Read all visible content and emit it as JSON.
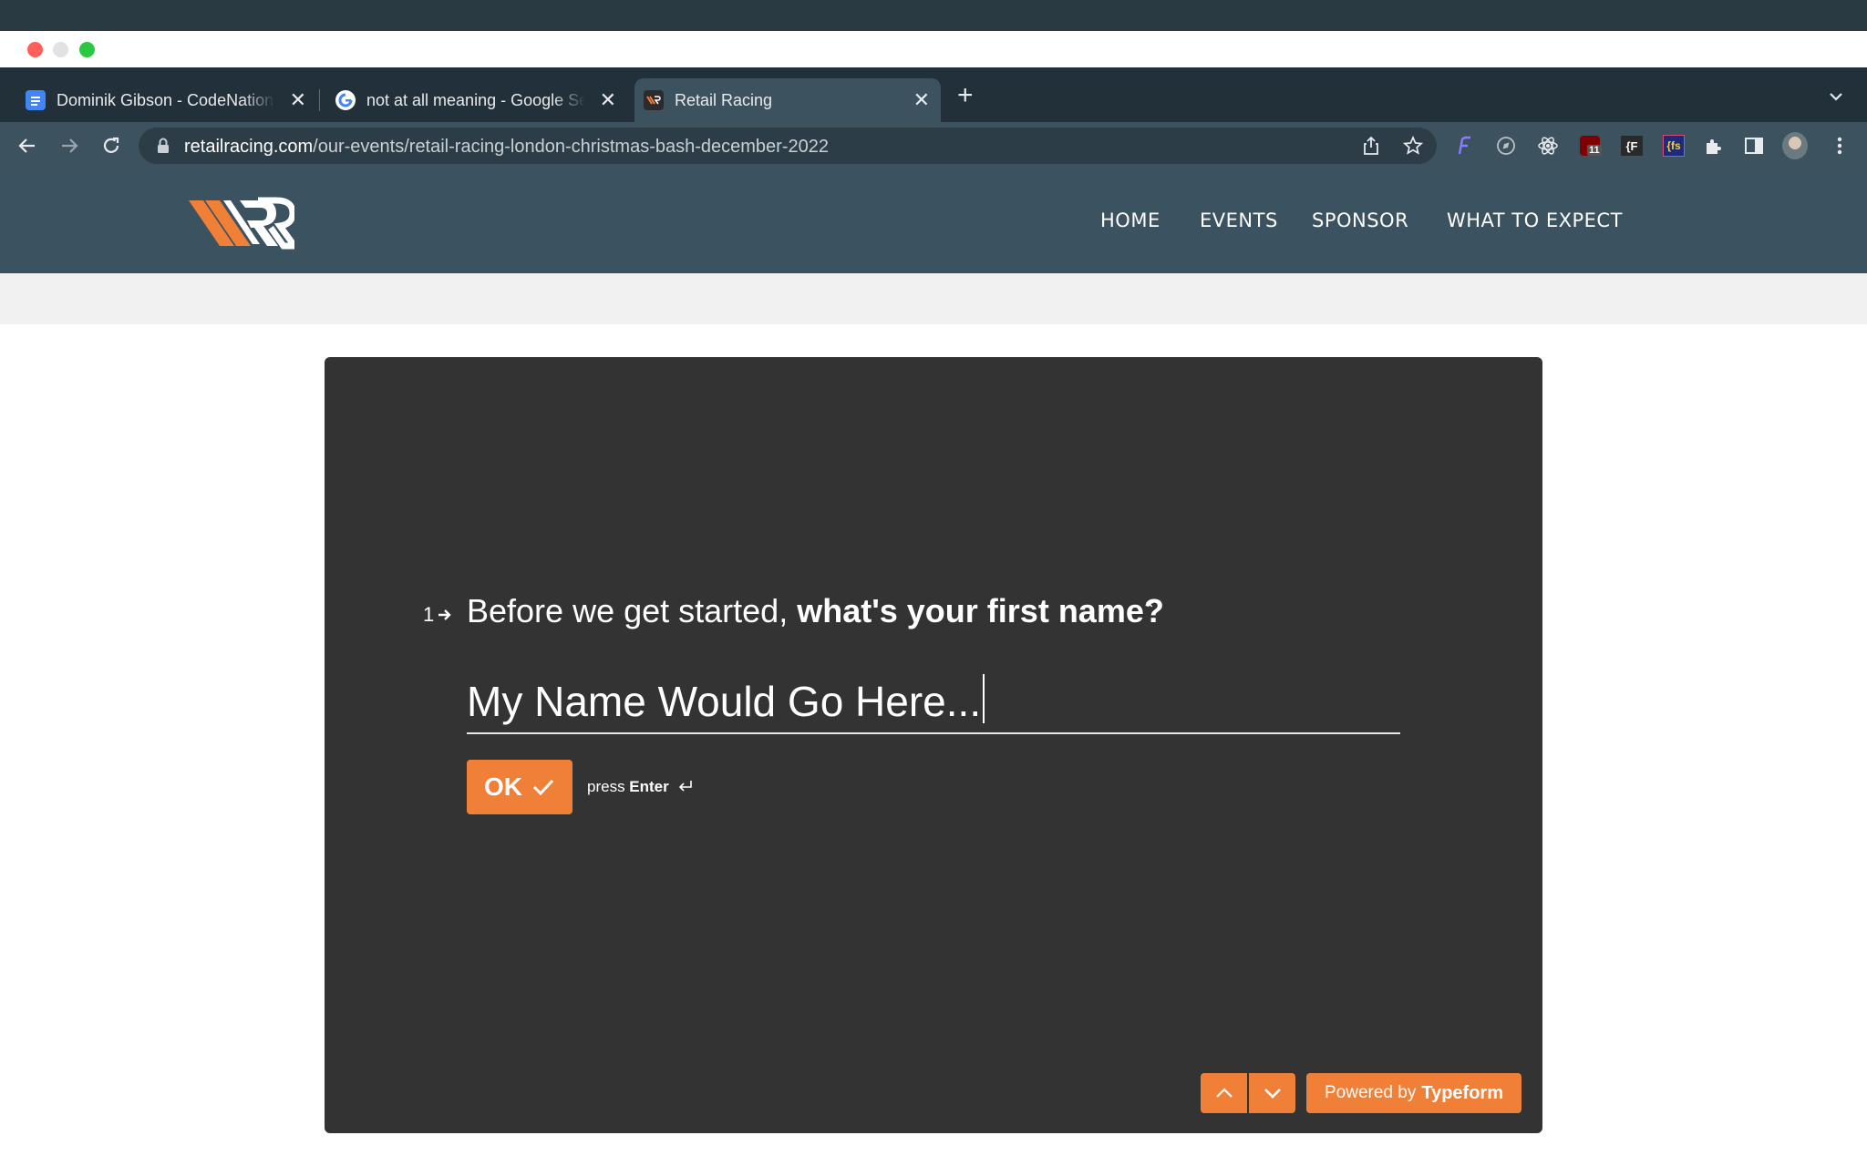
{
  "browser": {
    "tabs": [
      {
        "label": "Dominik Gibson - CodeNation",
        "active": false
      },
      {
        "label": "not at all meaning - Google Search",
        "active": false
      },
      {
        "label": "Retail Racing",
        "active": true
      }
    ],
    "url_host": "retailracing.com",
    "url_path": "/our-events/retail-racing-london-christmas-bash-december-2022",
    "extension_badge": "11"
  },
  "site": {
    "nav": [
      "HOME",
      "EVENTS",
      "SPONSOR",
      "WHAT TO EXPECT"
    ]
  },
  "form": {
    "question_number": "1",
    "question_prefix": "Before we get started, ",
    "question_bold": "what's your first name?",
    "required_mark": "*",
    "answer_value": "My Name Would Go Here...",
    "ok_label": "OK",
    "hint_prefix": "press ",
    "hint_key": "Enter",
    "powered_prefix": "Powered by",
    "powered_brand": "Typeform"
  },
  "colors": {
    "accent": "#f07f37",
    "header_bg": "#3b5260",
    "panel_bg": "#333333"
  }
}
